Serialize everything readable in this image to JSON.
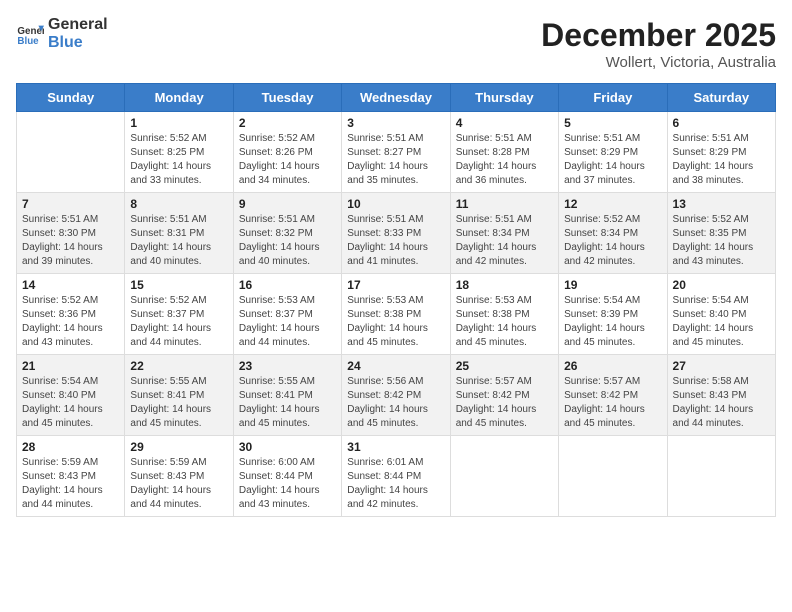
{
  "logo": {
    "text_general": "General",
    "text_blue": "Blue",
    "icon_alt": "GeneralBlue logo"
  },
  "title": "December 2025",
  "subtitle": "Wollert, Victoria, Australia",
  "days_of_week": [
    "Sunday",
    "Monday",
    "Tuesday",
    "Wednesday",
    "Thursday",
    "Friday",
    "Saturday"
  ],
  "weeks": [
    [
      {
        "day": "",
        "info": ""
      },
      {
        "day": "1",
        "info": "Sunrise: 5:52 AM\nSunset: 8:25 PM\nDaylight: 14 hours\nand 33 minutes."
      },
      {
        "day": "2",
        "info": "Sunrise: 5:52 AM\nSunset: 8:26 PM\nDaylight: 14 hours\nand 34 minutes."
      },
      {
        "day": "3",
        "info": "Sunrise: 5:51 AM\nSunset: 8:27 PM\nDaylight: 14 hours\nand 35 minutes."
      },
      {
        "day": "4",
        "info": "Sunrise: 5:51 AM\nSunset: 8:28 PM\nDaylight: 14 hours\nand 36 minutes."
      },
      {
        "day": "5",
        "info": "Sunrise: 5:51 AM\nSunset: 8:29 PM\nDaylight: 14 hours\nand 37 minutes."
      },
      {
        "day": "6",
        "info": "Sunrise: 5:51 AM\nSunset: 8:29 PM\nDaylight: 14 hours\nand 38 minutes."
      }
    ],
    [
      {
        "day": "7",
        "info": "Sunrise: 5:51 AM\nSunset: 8:30 PM\nDaylight: 14 hours\nand 39 minutes."
      },
      {
        "day": "8",
        "info": "Sunrise: 5:51 AM\nSunset: 8:31 PM\nDaylight: 14 hours\nand 40 minutes."
      },
      {
        "day": "9",
        "info": "Sunrise: 5:51 AM\nSunset: 8:32 PM\nDaylight: 14 hours\nand 40 minutes."
      },
      {
        "day": "10",
        "info": "Sunrise: 5:51 AM\nSunset: 8:33 PM\nDaylight: 14 hours\nand 41 minutes."
      },
      {
        "day": "11",
        "info": "Sunrise: 5:51 AM\nSunset: 8:34 PM\nDaylight: 14 hours\nand 42 minutes."
      },
      {
        "day": "12",
        "info": "Sunrise: 5:52 AM\nSunset: 8:34 PM\nDaylight: 14 hours\nand 42 minutes."
      },
      {
        "day": "13",
        "info": "Sunrise: 5:52 AM\nSunset: 8:35 PM\nDaylight: 14 hours\nand 43 minutes."
      }
    ],
    [
      {
        "day": "14",
        "info": "Sunrise: 5:52 AM\nSunset: 8:36 PM\nDaylight: 14 hours\nand 43 minutes."
      },
      {
        "day": "15",
        "info": "Sunrise: 5:52 AM\nSunset: 8:37 PM\nDaylight: 14 hours\nand 44 minutes."
      },
      {
        "day": "16",
        "info": "Sunrise: 5:53 AM\nSunset: 8:37 PM\nDaylight: 14 hours\nand 44 minutes."
      },
      {
        "day": "17",
        "info": "Sunrise: 5:53 AM\nSunset: 8:38 PM\nDaylight: 14 hours\nand 45 minutes."
      },
      {
        "day": "18",
        "info": "Sunrise: 5:53 AM\nSunset: 8:38 PM\nDaylight: 14 hours\nand 45 minutes."
      },
      {
        "day": "19",
        "info": "Sunrise: 5:54 AM\nSunset: 8:39 PM\nDaylight: 14 hours\nand 45 minutes."
      },
      {
        "day": "20",
        "info": "Sunrise: 5:54 AM\nSunset: 8:40 PM\nDaylight: 14 hours\nand 45 minutes."
      }
    ],
    [
      {
        "day": "21",
        "info": "Sunrise: 5:54 AM\nSunset: 8:40 PM\nDaylight: 14 hours\nand 45 minutes."
      },
      {
        "day": "22",
        "info": "Sunrise: 5:55 AM\nSunset: 8:41 PM\nDaylight: 14 hours\nand 45 minutes."
      },
      {
        "day": "23",
        "info": "Sunrise: 5:55 AM\nSunset: 8:41 PM\nDaylight: 14 hours\nand 45 minutes."
      },
      {
        "day": "24",
        "info": "Sunrise: 5:56 AM\nSunset: 8:42 PM\nDaylight: 14 hours\nand 45 minutes."
      },
      {
        "day": "25",
        "info": "Sunrise: 5:57 AM\nSunset: 8:42 PM\nDaylight: 14 hours\nand 45 minutes."
      },
      {
        "day": "26",
        "info": "Sunrise: 5:57 AM\nSunset: 8:42 PM\nDaylight: 14 hours\nand 45 minutes."
      },
      {
        "day": "27",
        "info": "Sunrise: 5:58 AM\nSunset: 8:43 PM\nDaylight: 14 hours\nand 44 minutes."
      }
    ],
    [
      {
        "day": "28",
        "info": "Sunrise: 5:59 AM\nSunset: 8:43 PM\nDaylight: 14 hours\nand 44 minutes."
      },
      {
        "day": "29",
        "info": "Sunrise: 5:59 AM\nSunset: 8:43 PM\nDaylight: 14 hours\nand 44 minutes."
      },
      {
        "day": "30",
        "info": "Sunrise: 6:00 AM\nSunset: 8:44 PM\nDaylight: 14 hours\nand 43 minutes."
      },
      {
        "day": "31",
        "info": "Sunrise: 6:01 AM\nSunset: 8:44 PM\nDaylight: 14 hours\nand 42 minutes."
      },
      {
        "day": "",
        "info": ""
      },
      {
        "day": "",
        "info": ""
      },
      {
        "day": "",
        "info": ""
      }
    ]
  ]
}
